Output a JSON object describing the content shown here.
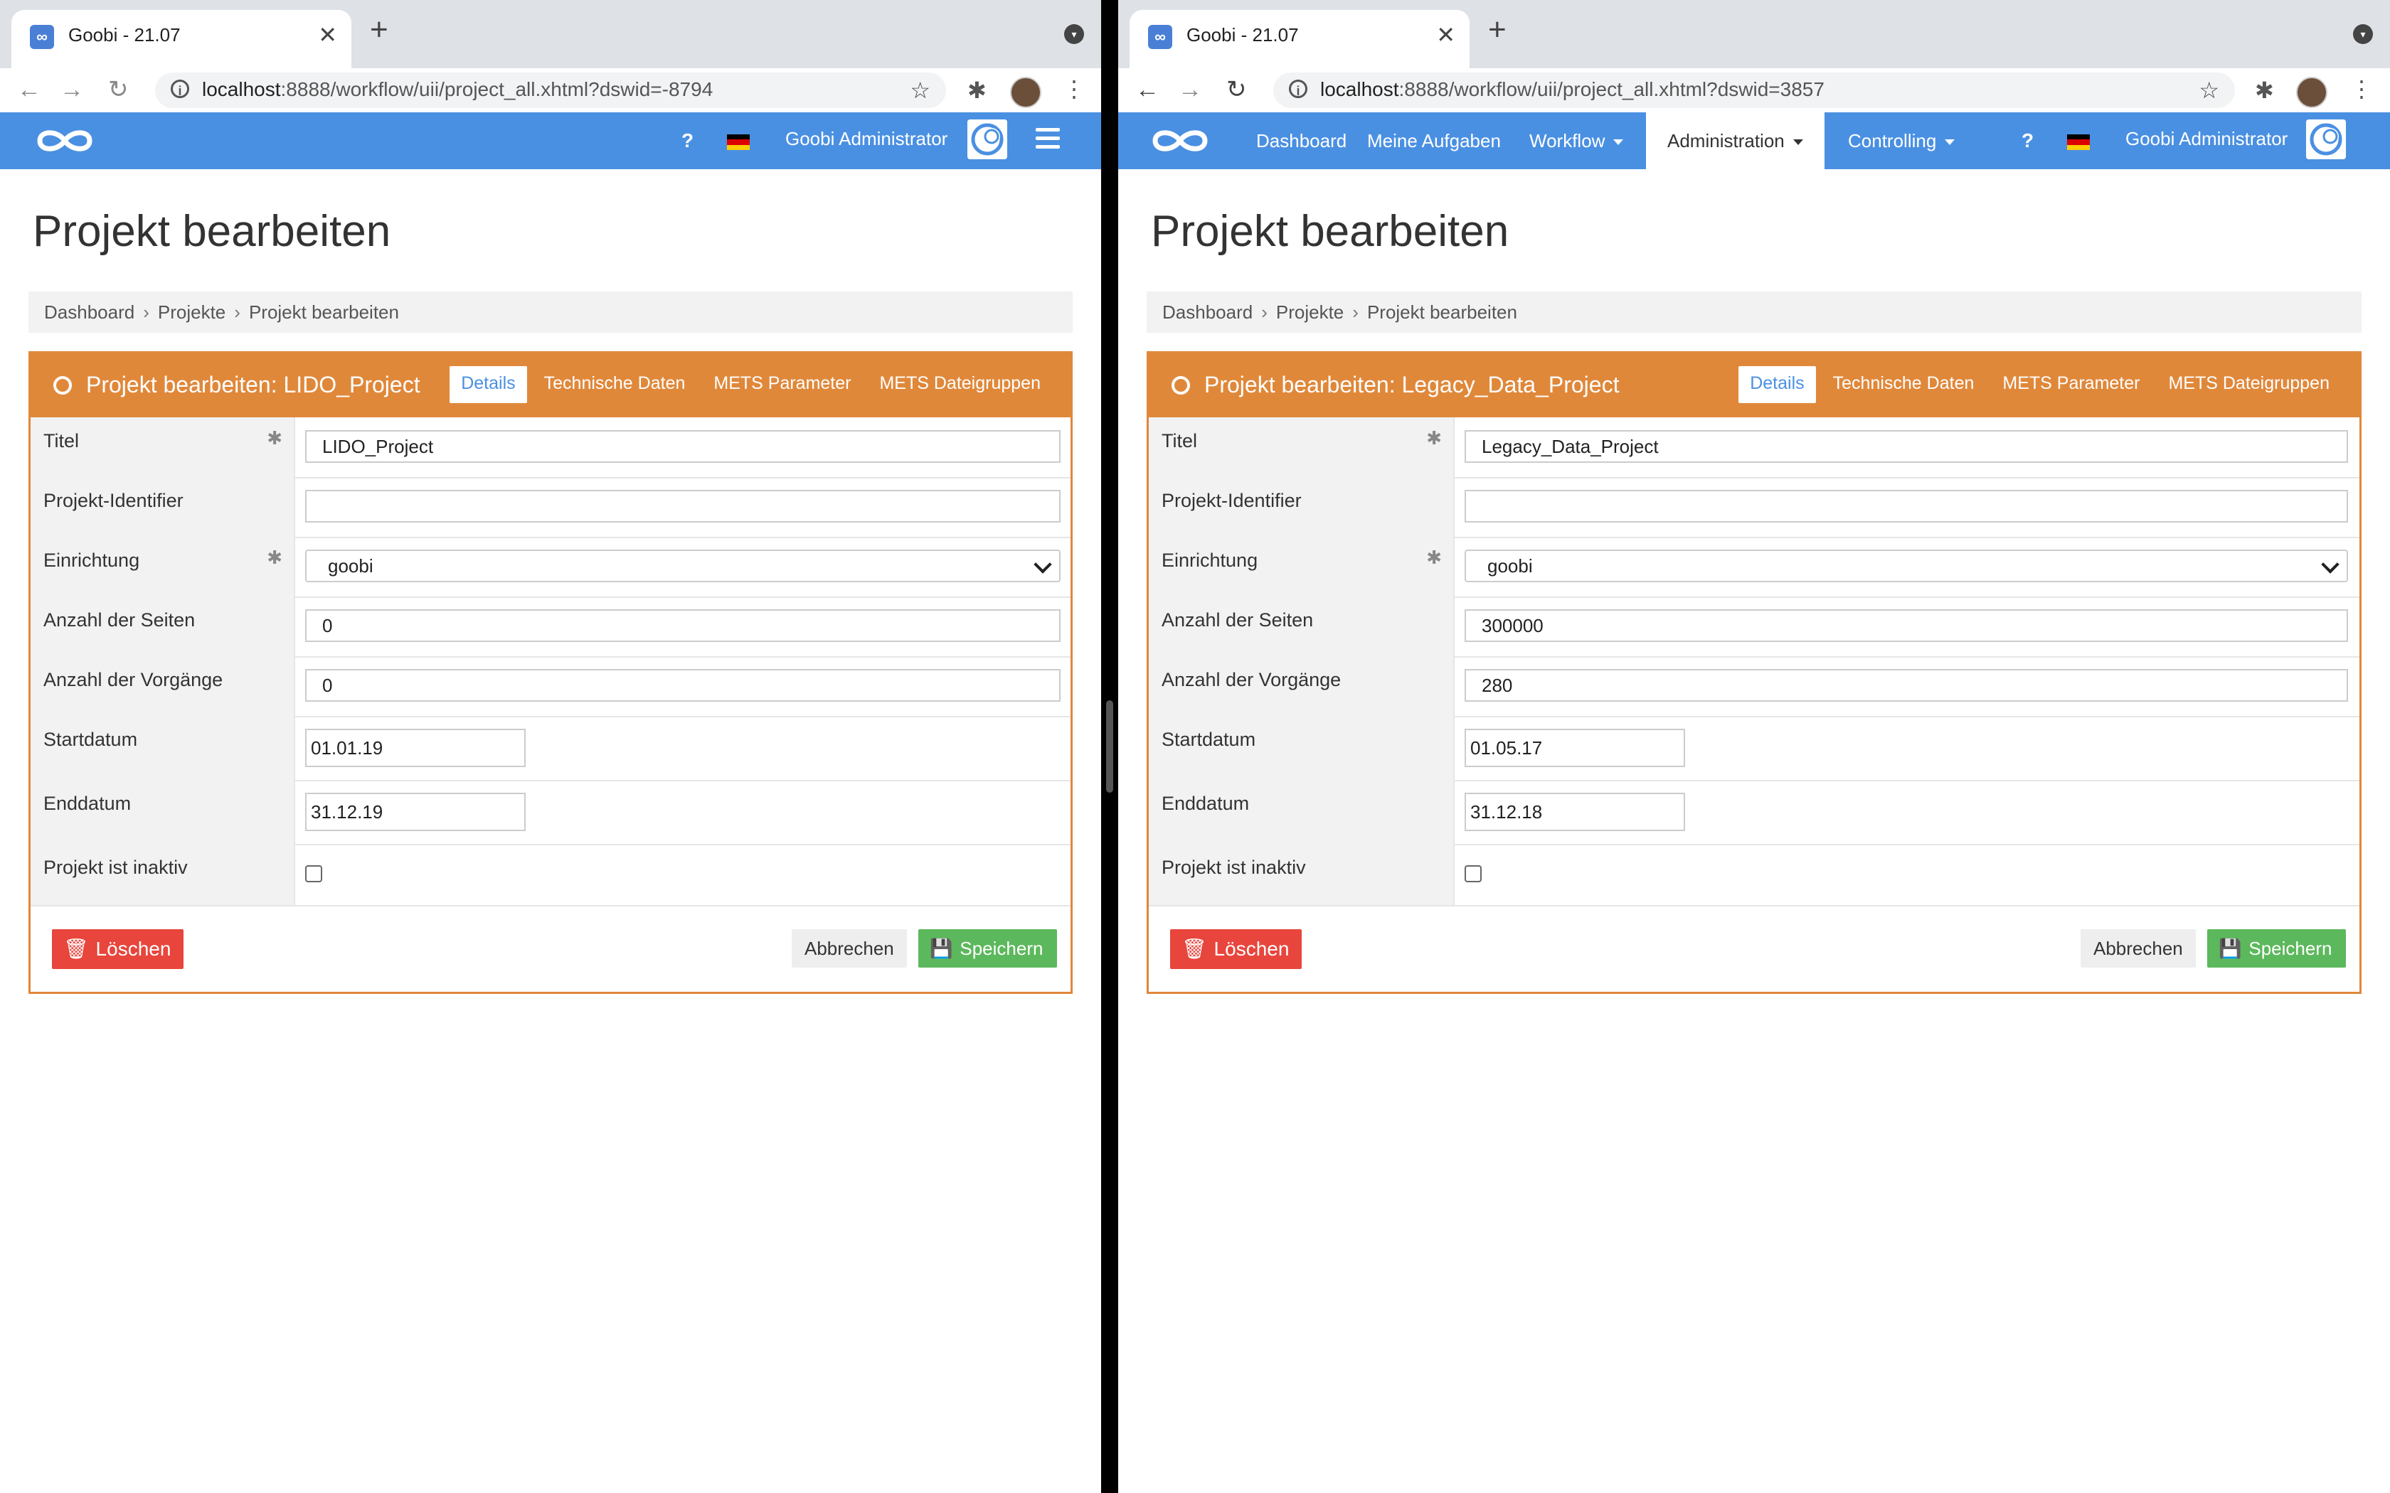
{
  "left": {
    "tab_title": "Goobi - 21.07",
    "url_host": "localhost",
    "url_path": ":8888/workflow/uii/project_all.xhtml?dswid=-8794",
    "nav": {
      "help": "?",
      "user": "Goobi Administrator"
    },
    "page_title": "Projekt bearbeiten",
    "breadcrumb": [
      "Dashboard",
      "Projekte",
      "Projekt bearbeiten"
    ],
    "box_title": "Projekt bearbeiten: LIDO_Project",
    "tabs": [
      "Details",
      "Technische Daten",
      "METS Parameter",
      "METS Dateigruppen"
    ],
    "fields": {
      "titel_label": "Titel",
      "titel_value": "LIDO_Project",
      "identifier_label": "Projekt-Identifier",
      "identifier_value": "",
      "einrichtung_label": "Einrichtung",
      "einrichtung_value": "goobi",
      "seiten_label": "Anzahl der Seiten",
      "seiten_value": "0",
      "vorgaenge_label": "Anzahl der Vorgänge",
      "vorgaenge_value": "0",
      "start_label": "Startdatum",
      "start_value": "01.01.19",
      "end_label": "Enddatum",
      "end_value": "31.12.19",
      "inaktiv_label": "Projekt ist inaktiv"
    },
    "buttons": {
      "delete": "Löschen",
      "cancel": "Abbrechen",
      "save": "Speichern"
    }
  },
  "right": {
    "tab_title": "Goobi - 21.07",
    "url_host": "localhost",
    "url_path": ":8888/workflow/uii/project_all.xhtml?dswid=3857",
    "nav": {
      "menu": [
        "Dashboard",
        "Meine Aufgaben",
        "Workflow",
        "Administration",
        "Controlling"
      ],
      "help": "?",
      "user": "Goobi Administrator"
    },
    "page_title": "Projekt bearbeiten",
    "breadcrumb": [
      "Dashboard",
      "Projekte",
      "Projekt bearbeiten"
    ],
    "box_title": "Projekt bearbeiten: Legacy_Data_Project",
    "tabs": [
      "Details",
      "Technische Daten",
      "METS Parameter",
      "METS Dateigruppen"
    ],
    "fields": {
      "titel_label": "Titel",
      "titel_value": "Legacy_Data_Project",
      "identifier_label": "Projekt-Identifier",
      "identifier_value": "",
      "einrichtung_label": "Einrichtung",
      "einrichtung_value": "goobi",
      "seiten_label": "Anzahl der Seiten",
      "seiten_value": "300000",
      "vorgaenge_label": "Anzahl der Vorgänge",
      "vorgaenge_value": "280",
      "start_label": "Startdatum",
      "start_value": "01.05.17",
      "end_label": "Enddatum",
      "end_value": "31.12.18",
      "inaktiv_label": "Projekt ist inaktiv"
    },
    "buttons": {
      "delete": "Löschen",
      "cancel": "Abbrechen",
      "save": "Speichern"
    }
  },
  "icons": {
    "favicon": "goobi-infinity-icon",
    "back": "arrow-left-icon",
    "forward": "arrow-right-icon",
    "reload": "reload-icon",
    "site_info": "info-icon",
    "bookmark": "star-icon",
    "extensions": "puzzle-icon",
    "box_header": "circle-target-icon",
    "delete": "trash-icon",
    "save": "floppy-disk-icon"
  },
  "colors": {
    "navbar": "#4a90e2",
    "box_accent": "#e0883a",
    "delete_button": "#e8453c",
    "save_button": "#5cb85c"
  }
}
